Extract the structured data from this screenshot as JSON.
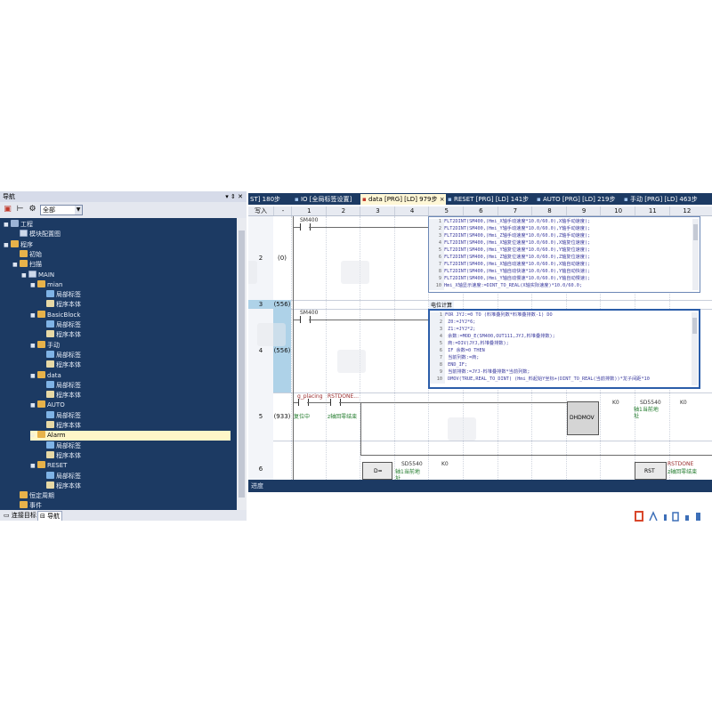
{
  "nav": {
    "title": "导航",
    "pin": "▾ ⇕ ✕",
    "filter": "全部",
    "tree": [
      {
        "label": "工程",
        "indent": 0,
        "icon": "proj",
        "tw": "▪"
      },
      {
        "label": "模块配置图",
        "indent": 1,
        "icon": "prog",
        "tw": ""
      },
      {
        "label": "程序",
        "indent": 0,
        "icon": "folder",
        "tw": "▪"
      },
      {
        "label": "初始",
        "indent": 1,
        "icon": "folder",
        "tw": ""
      },
      {
        "label": "扫描",
        "indent": 1,
        "icon": "folder",
        "tw": "▪"
      },
      {
        "label": "MAIN",
        "indent": 2,
        "icon": "prog",
        "tw": "▪"
      },
      {
        "label": "mian",
        "indent": 3,
        "icon": "folder",
        "tw": "▪"
      },
      {
        "label": "局部标签",
        "indent": 4,
        "icon": "label",
        "tw": ""
      },
      {
        "label": "程序本体",
        "indent": 4,
        "icon": "body",
        "tw": ""
      },
      {
        "label": "BasicBlock",
        "indent": 3,
        "icon": "folder",
        "tw": "▪"
      },
      {
        "label": "局部标签",
        "indent": 4,
        "icon": "label",
        "tw": ""
      },
      {
        "label": "程序本体",
        "indent": 4,
        "icon": "body",
        "tw": ""
      },
      {
        "label": "手动",
        "indent": 3,
        "icon": "folder",
        "tw": "▪"
      },
      {
        "label": "局部标签",
        "indent": 4,
        "icon": "label",
        "tw": ""
      },
      {
        "label": "程序本体",
        "indent": 4,
        "icon": "body",
        "tw": ""
      },
      {
        "label": "data",
        "indent": 3,
        "icon": "folder",
        "tw": "▪"
      },
      {
        "label": "局部标签",
        "indent": 4,
        "icon": "label",
        "tw": ""
      },
      {
        "label": "程序本体",
        "indent": 4,
        "icon": "body",
        "tw": ""
      },
      {
        "label": "AUTO",
        "indent": 3,
        "icon": "folder",
        "tw": "▪"
      },
      {
        "label": "局部标签",
        "indent": 4,
        "icon": "label",
        "tw": ""
      },
      {
        "label": "程序本体",
        "indent": 4,
        "icon": "body",
        "tw": ""
      },
      {
        "label": "Alarm",
        "indent": 3,
        "icon": "folder",
        "tw": "▫",
        "selected": true
      },
      {
        "label": "局部标签",
        "indent": 4,
        "icon": "label",
        "tw": ""
      },
      {
        "label": "程序本体",
        "indent": 4,
        "icon": "body",
        "tw": ""
      },
      {
        "label": "RESET",
        "indent": 3,
        "icon": "folder",
        "tw": "▪"
      },
      {
        "label": "局部标签",
        "indent": 4,
        "icon": "label",
        "tw": ""
      },
      {
        "label": "程序本体",
        "indent": 4,
        "icon": "body",
        "tw": ""
      },
      {
        "label": "恒定周期",
        "indent": 1,
        "icon": "folder",
        "tw": ""
      },
      {
        "label": "事件",
        "indent": 1,
        "icon": "folder",
        "tw": ""
      }
    ],
    "bottom_tabs": [
      "连接目标",
      "导航"
    ]
  },
  "editor": {
    "tabs": [
      {
        "label": "ST] 180步",
        "active": false
      },
      {
        "label": "IO [全局标签设置]",
        "active": false
      },
      {
        "label": "data [PRG] [LD] 979步 ×",
        "active": true
      },
      {
        "label": "RESET [PRG] [LD] 141步",
        "active": false
      },
      {
        "label": "AUTO [PRG] [LD] 219步",
        "active": false
      },
      {
        "label": "手动 [PRG] [LD] 463步",
        "active": false
      }
    ],
    "col_header_first": "写入",
    "col_header_dash": "-",
    "columns": [
      "1",
      "2",
      "3",
      "4",
      "5",
      "6",
      "7",
      "8",
      "9",
      "10",
      "11",
      "12"
    ],
    "rows": [
      {
        "num": "2",
        "step": "(0)"
      },
      {
        "num": "3",
        "step": "(556)"
      },
      {
        "num": "4",
        "step": "(556)"
      },
      {
        "num": "5",
        "step": "(933)"
      },
      {
        "num": "6",
        "step": ""
      }
    ],
    "rung2_contact": "SM400",
    "rung4_contact": "SM400",
    "rung5": {
      "contact1": "g_placing",
      "comment1": "复位中",
      "contact2": "RSTDONE...",
      "comment2": "z轴回零结束",
      "fn": "DMOV",
      "fn_prefix": "DH",
      "arg1": "K0",
      "arg2": "SD5540",
      "arg2_comment": "轴1当前地址",
      "arg3": "K0"
    },
    "rung6": {
      "box1_prefix": "D",
      "box1_op": "=",
      "arg1": "SD5540",
      "arg1_comment": "轴1当前地址",
      "arg2": "K0",
      "box2": "RST",
      "arg3": "RSTDONE",
      "arg3_comment": "z轴回零结束"
    },
    "block1": {
      "lines": [
        {
          "n": "1",
          "t": "FLT2DINT(SM400,(Hmi_X轴手动速度*10.0/60.0),X轴手动速度);"
        },
        {
          "n": "2",
          "t": "FLT2DINT(SM400,(Hmi_Y轴手动速度*10.0/60.0),Y轴手动速度);"
        },
        {
          "n": "3",
          "t": "FLT2DINT(SM400,(Hmi_Z轴手动速度*10.0/60.0),Z轴手动速度);"
        },
        {
          "n": "4",
          "t": "FLT2DINT(SM400,(Hmi_X轴复位速度*10.0/60.0),X轴复位速度);"
        },
        {
          "n": "5",
          "t": "FLT2DINT(SM400,(Hmi_Y轴复位速度*10.0/60.0),Y轴复位速度);"
        },
        {
          "n": "6",
          "t": "FLT2DINT(SM400,(Hmi_Z轴复位速度*10.0/60.0),Z轴复位速度);"
        },
        {
          "n": "7",
          "t": "FLT2DINT(SM400,(Hmi_X轴自动速度*10.0/60.0),X轴自动速度);"
        },
        {
          "n": "8",
          "t": "FLT2DINT(SM400,(Hmi_Y轴自动快速*10.0/60.0),Y轴自动快速);"
        },
        {
          "n": "9",
          "t": "FLT2DINT(SM400,(Hmi_Y轴自动慢速*10.0/60.0),Y轴自动慢速);"
        },
        {
          "n": "10",
          "t": "Hmi_X轴显示速度:=DINT_TO_REAL(X轴实际速度)*10.0/60.0;"
        }
      ]
    },
    "block2": {
      "title": "电位计算",
      "lines": [
        {
          "n": "1",
          "t": "FOR JYJ:=0 TO (料堆叠列数*料堆叠排数-1) DO"
        },
        {
          "n": "2",
          "t": "   Z0:=JYJ*6;"
        },
        {
          "n": "3",
          "t": "   Z1:=JYJ*2;"
        },
        {
          "n": "4",
          "t": "   余数:=MOD_E(SM400,OUT111,JYJ,料堆叠排数);"
        },
        {
          "n": "5",
          "t": "   商:=DIV(JYJ,料堆叠排数);"
        },
        {
          "n": "6",
          "t": "   IF 余数=0 THEN"
        },
        {
          "n": "7",
          "t": "      当前列数:=商;"
        },
        {
          "n": "8",
          "t": "   END_IF;"
        },
        {
          "n": "9",
          "t": "   当前排数:=JYJ-料堆叠排数*当前列数;"
        },
        {
          "n": "10",
          "t": "   DMOV(TRUE,REAL_TO_DINT( (Hmi_料起始Y坐标+(DINT_TO_REAL(当前排数))*龙子间距*10"
        }
      ]
    },
    "status_bar": "进度"
  },
  "colors": {
    "frame": "#1c3a63",
    "active_tab": "#fff7d6",
    "highlight_row": "#aed2e8",
    "comment_green": "#1f7a2a",
    "code_blue": "#3b3b9e"
  }
}
